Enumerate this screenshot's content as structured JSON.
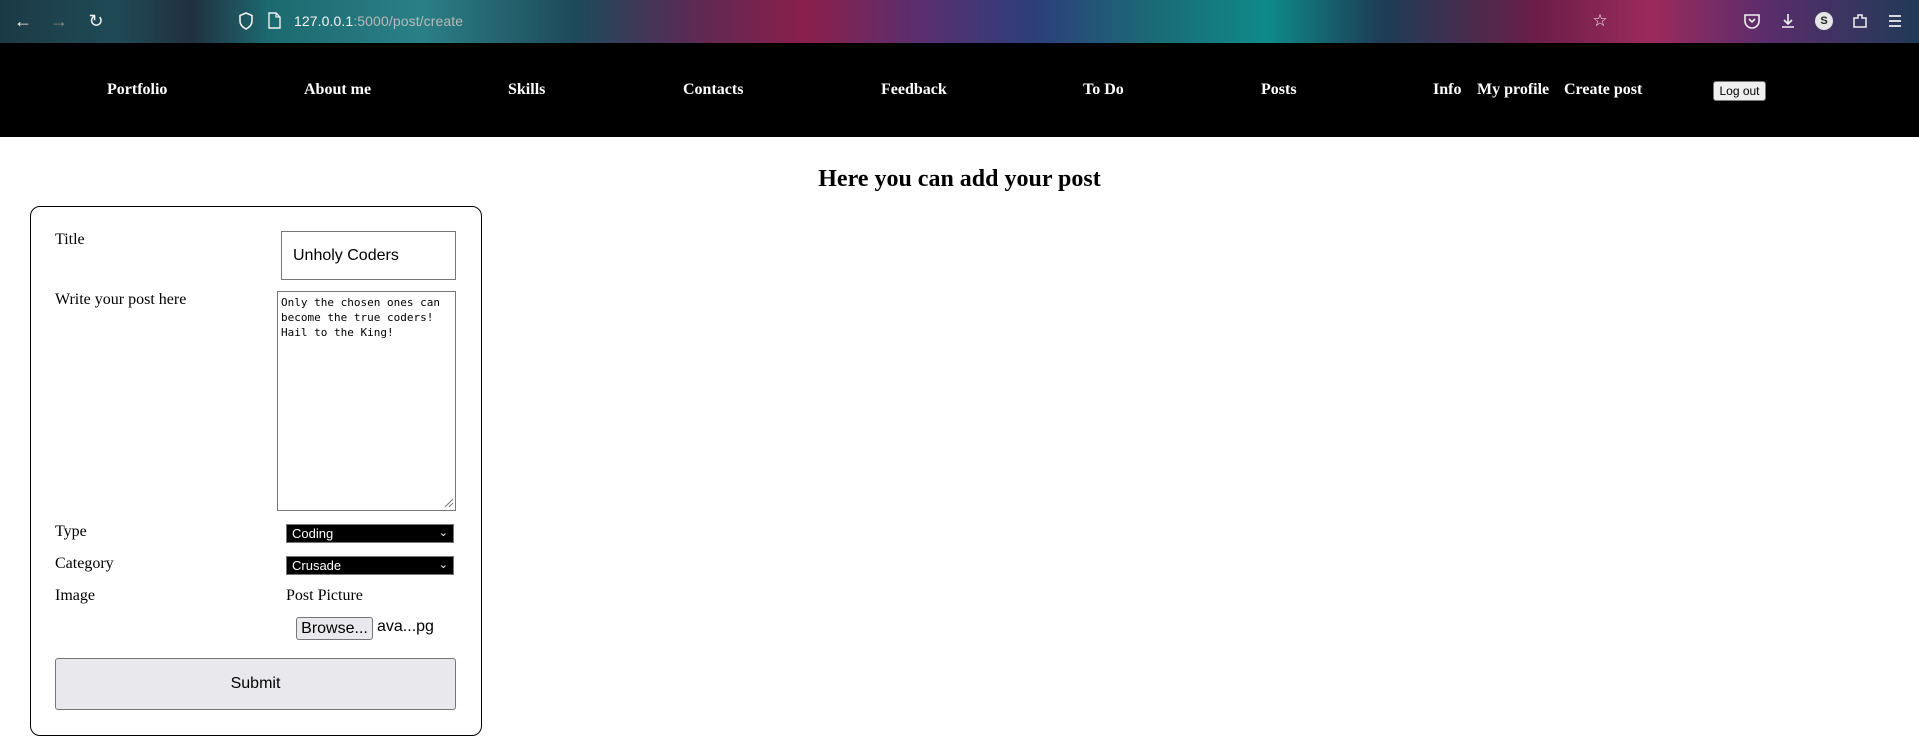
{
  "browser": {
    "url_host": "127.0.0.1",
    "url_rest": ":5000/post/create",
    "profile_initial": "S"
  },
  "nav": {
    "links": [
      "Portfolio",
      "About me",
      "Skills",
      "Contacts",
      "Feedback",
      "To Do",
      "Posts",
      "Info",
      "My profile",
      "Create post"
    ],
    "logout_label": "Log out"
  },
  "page": {
    "heading": "Here you can add your post"
  },
  "form": {
    "title_label": "Title",
    "title_value": "Unholy Coders",
    "post_label": "Write your post here",
    "post_value": "Only the chosen ones can\nbecome the true coders!\nHail to the King!",
    "type_label": "Type",
    "type_value": "Coding",
    "category_label": "Category",
    "category_value": "Crusade",
    "image_label": "Image",
    "post_picture_label": "Post Picture",
    "browse_label": "Browse...",
    "file_name": "ava...pg",
    "submit_label": "Submit"
  }
}
